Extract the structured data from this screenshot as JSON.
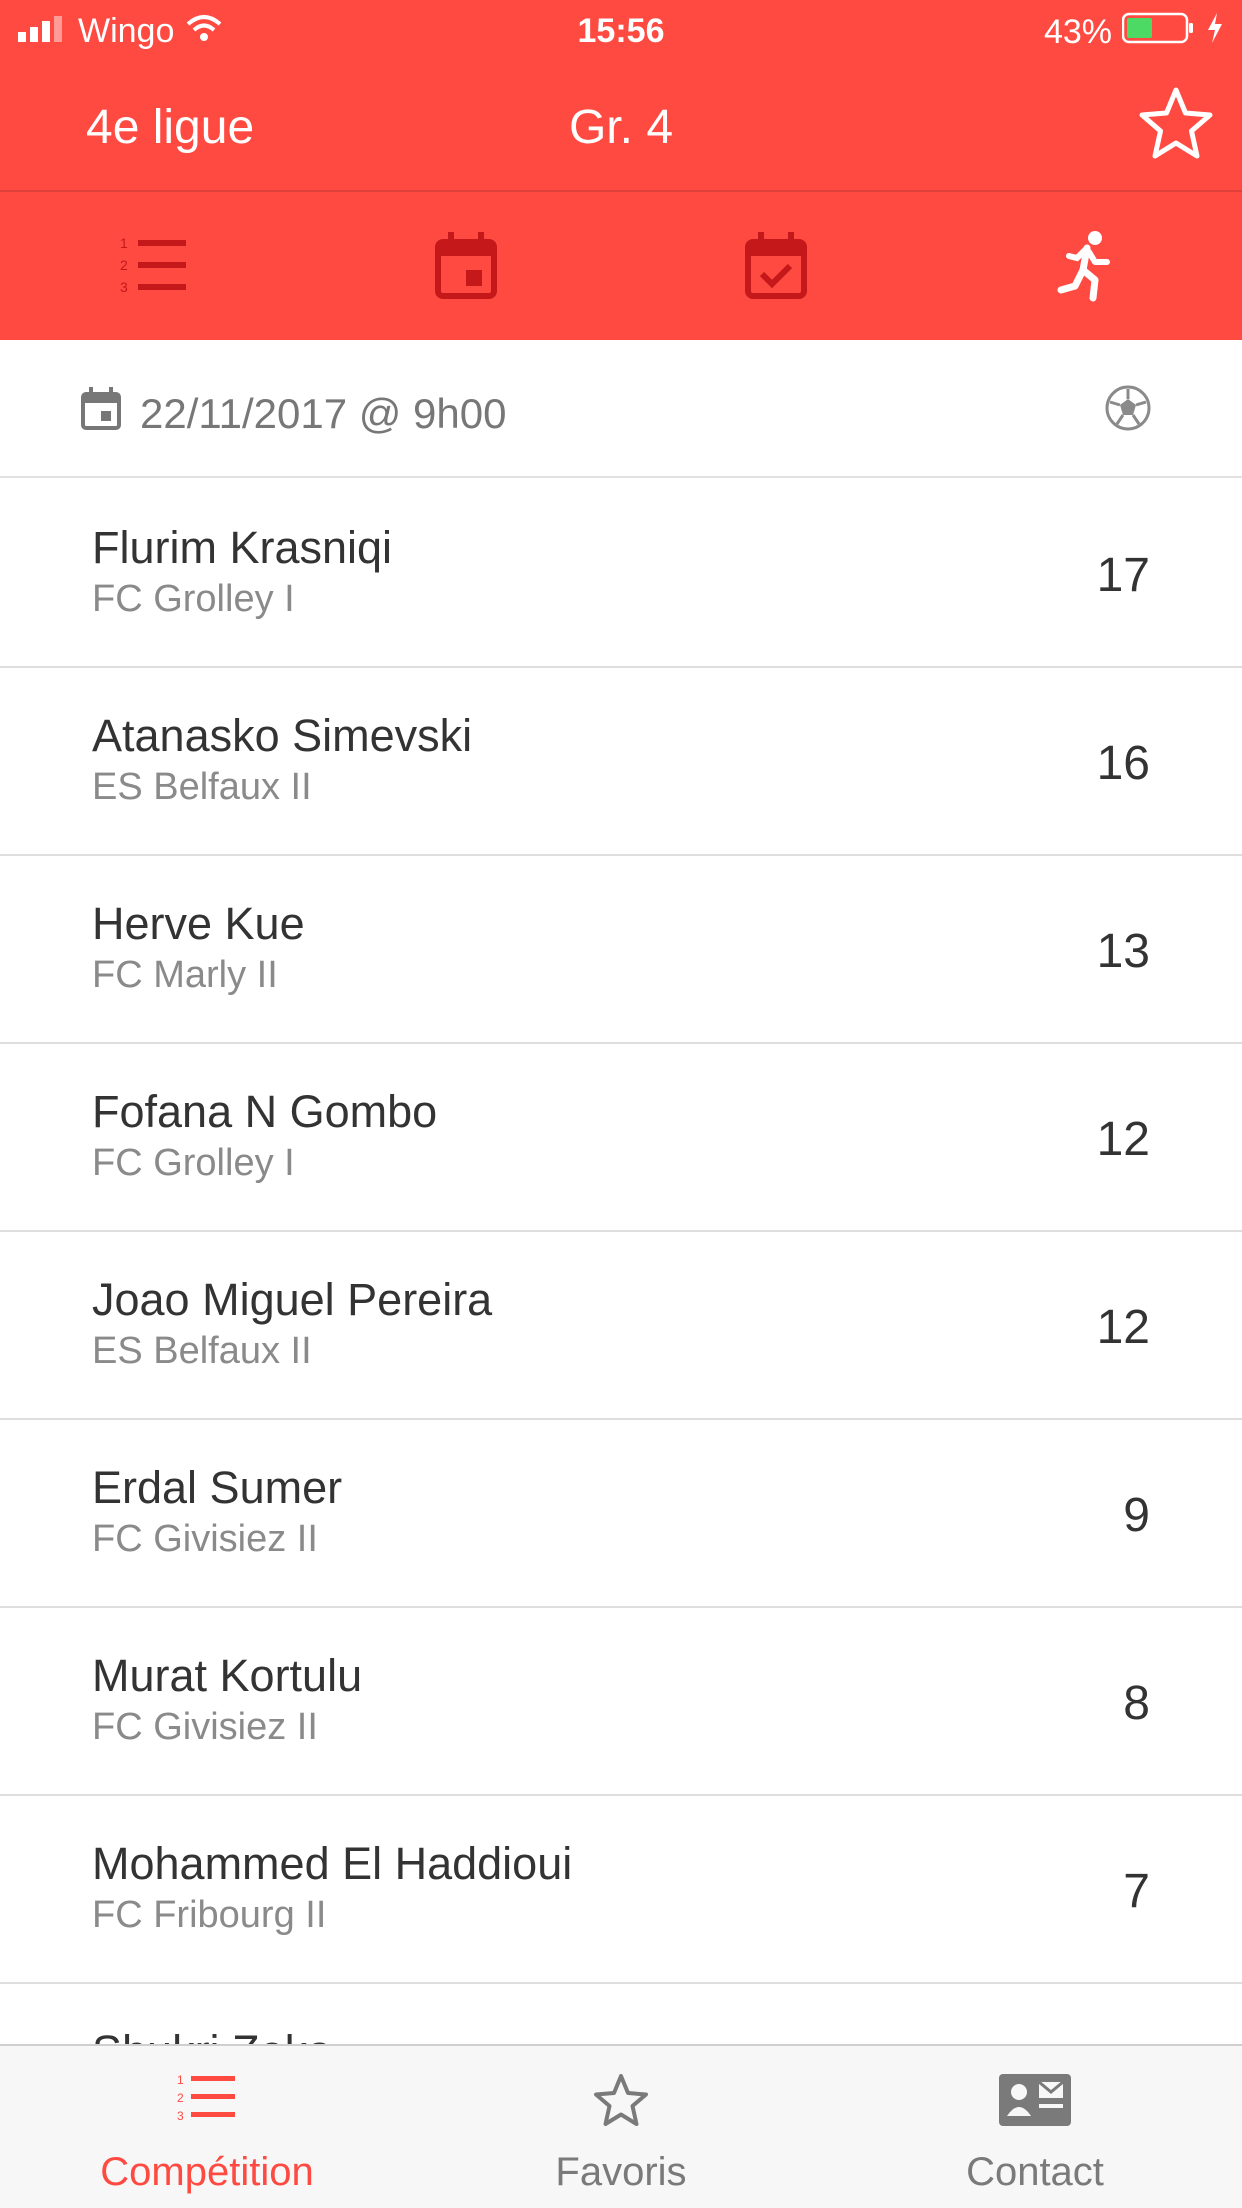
{
  "status_bar": {
    "carrier": "Wingo",
    "time": "15:56",
    "battery": "43%"
  },
  "nav": {
    "back_label": "4e ligue",
    "title": "Gr. 4"
  },
  "toolbar": {
    "tabs": [
      {
        "icon": "ranking-list-icon"
      },
      {
        "icon": "calendar-icon"
      },
      {
        "icon": "calendar-check-icon"
      },
      {
        "icon": "runner-icon",
        "active": true
      }
    ]
  },
  "date_row": {
    "text": "22/11/2017 @ 9h00",
    "icon": "soccer-ball-icon"
  },
  "scorers": [
    {
      "name": "Flurim Krasniqi",
      "team": "FC Grolley I",
      "goals": "17"
    },
    {
      "name": "Atanasko Simevski",
      "team": "ES Belfaux II",
      "goals": "16"
    },
    {
      "name": "Herve Kue",
      "team": "FC Marly II",
      "goals": "13"
    },
    {
      "name": "Fofana N Gombo",
      "team": "FC Grolley I",
      "goals": "12"
    },
    {
      "name": "Joao Miguel Pereira",
      "team": "ES Belfaux II",
      "goals": "12"
    },
    {
      "name": "Erdal Sumer",
      "team": "FC Givisiez II",
      "goals": "9"
    },
    {
      "name": "Murat Kortulu",
      "team": "FC Givisiez II",
      "goals": "8"
    },
    {
      "name": "Mohammed El Haddioui",
      "team": "FC Fribourg II",
      "goals": "7"
    },
    {
      "name": "Shukri Zeka",
      "team": "",
      "goals": ""
    }
  ],
  "tab_bar": {
    "tabs": [
      {
        "label": "Compétition",
        "active": true
      },
      {
        "label": "Favoris"
      },
      {
        "label": "Contact"
      }
    ]
  },
  "colors": {
    "accent": "#ff4a42",
    "dark_red": "#c4181a",
    "active_tab": "#ff4a42",
    "inactive_tab": "#7a7a7a"
  }
}
